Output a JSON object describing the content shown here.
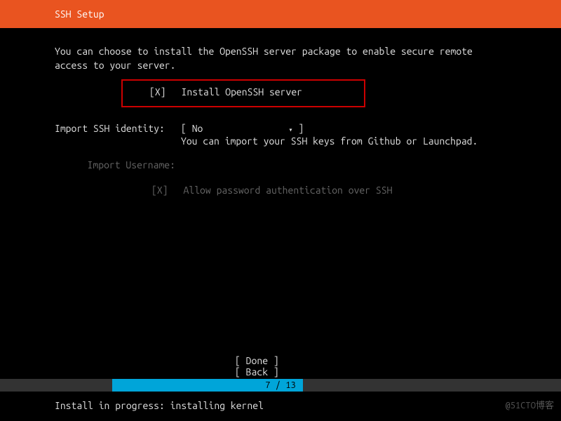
{
  "header": {
    "title": "SSH Setup"
  },
  "intro": {
    "line1": "You can choose to install the OpenSSH server package to enable secure remote",
    "line2": "access to your server."
  },
  "install_openssh": {
    "checkbox": "[X]",
    "label": "Install OpenSSH server"
  },
  "import_identity": {
    "label": "Import SSH identity:",
    "bracket_open": "[",
    "value": "No",
    "bracket_close": "]",
    "hint": "You can import your SSH keys from Github or Launchpad."
  },
  "import_username": {
    "label": "Import Username:"
  },
  "allow_password": {
    "checkbox": "[X]",
    "label": "Allow password authentication over SSH"
  },
  "buttons": {
    "done": "[ Done       ]",
    "back": "[ Back       ]"
  },
  "progress": {
    "text": "7 / 13",
    "percent": 54
  },
  "status": "Install in progress: installing kernel",
  "watermark": "@51CTO博客"
}
